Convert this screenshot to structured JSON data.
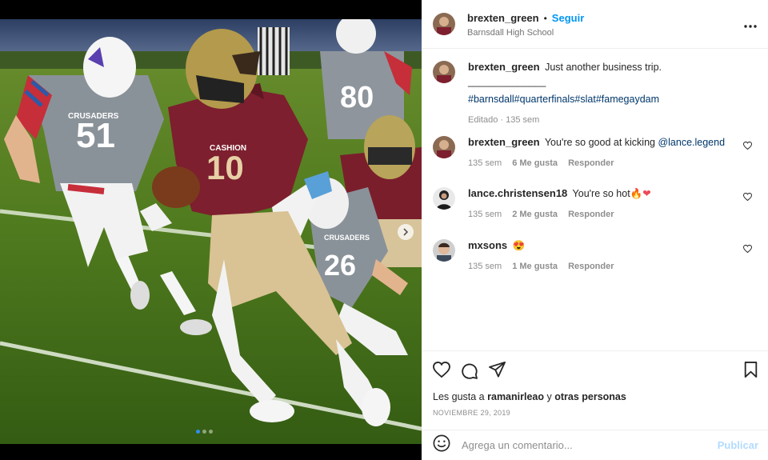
{
  "post": {
    "username": "brexten_green",
    "follow_dot": "•",
    "follow_label": "Seguir",
    "location": "Barnsdall High School"
  },
  "caption": {
    "username": "brexten_green",
    "text": "Just another business trip.",
    "divider": "______________",
    "hashtags": "#barnsdall#quarterfinals#slat#famegaydam",
    "meta_edited": "Editado · 135 sem"
  },
  "comments": [
    {
      "username": "brexten_green",
      "text": "You're so good at kicking ",
      "mention": "@lance.legend",
      "time": "135 sem",
      "likes": "6 Me gusta",
      "reply": "Responder"
    },
    {
      "username": "lance.christensen18",
      "text": "You're so hot",
      "emoji": "🔥❤",
      "time": "135 sem",
      "likes": "2 Me gusta",
      "reply": "Responder"
    },
    {
      "username": "mxsons",
      "emoji": "😍",
      "time": "135 sem",
      "likes": "1 Me gusta",
      "reply": "Responder"
    }
  ],
  "likes": {
    "prefix": "Les gusta a",
    "user": "ramanirleao",
    "connector": "y",
    "others": "otras personas"
  },
  "date": "NOVIEMBRE 29, 2019",
  "add_comment": {
    "placeholder": "Agrega un comentario...",
    "publish": "Publicar"
  },
  "photo": {
    "jersey_left": "51",
    "jersey_center": "10",
    "jersey_center_name": "CASHION",
    "jersey_right": "26",
    "jersey_back": "80",
    "team_name": "CRUSADERS"
  },
  "carousel": {
    "slides": 3,
    "active": 0
  },
  "icons": {
    "more": "more-options-icon",
    "like": "heart-icon",
    "comment": "comment-icon",
    "share": "share-icon",
    "save": "bookmark-icon",
    "emoji": "emoji-icon",
    "next": "chevron-right-icon"
  },
  "colors": {
    "link": "#0095f6",
    "link_disabled": "#b3dbff",
    "hashtag": "#00376b",
    "heart_red": "#ed4956"
  }
}
